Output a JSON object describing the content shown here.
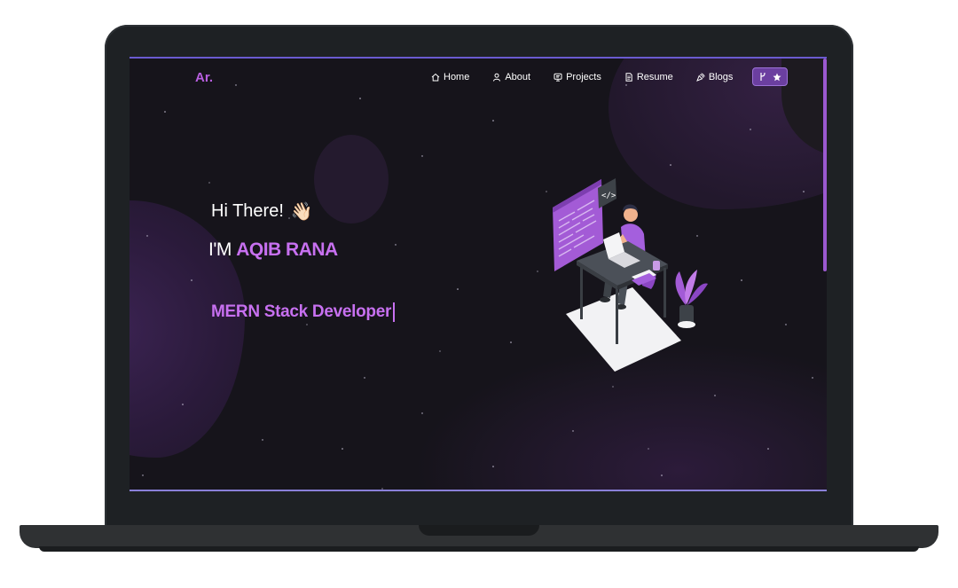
{
  "logo": "Ar.",
  "nav": {
    "items": [
      {
        "label": "Home",
        "icon": "home-icon"
      },
      {
        "label": "About",
        "icon": "user-icon"
      },
      {
        "label": "Projects",
        "icon": "projects-icon"
      },
      {
        "label": "Resume",
        "icon": "document-icon"
      },
      {
        "label": "Blogs",
        "icon": "blog-icon"
      }
    ],
    "fork_button": {
      "icons": [
        "git-fork-icon",
        "star-icon"
      ]
    }
  },
  "hero": {
    "greeting": "Hi There!",
    "greeting_emoji": "👋🏻",
    "prefix": "I'M",
    "name": "AQIB RANA",
    "role": "MERN Stack Developer"
  },
  "colors": {
    "accent": "#c770f0",
    "background": "#16141b",
    "button": "#6b3fa0"
  }
}
